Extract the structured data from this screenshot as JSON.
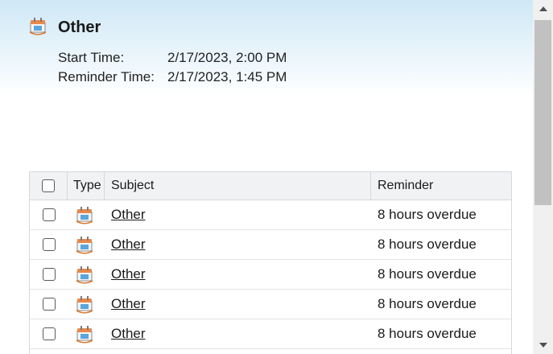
{
  "reminder": {
    "title": "Other",
    "icon": "calendar-appointment-icon",
    "start_label": "Start Time:",
    "start_value": "2/17/2023, 2:00 PM",
    "reminder_label": "Reminder Time:",
    "reminder_value": "2/17/2023, 1:45 PM"
  },
  "table": {
    "headers": {
      "type": "Type",
      "subject": "Subject",
      "reminder": "Reminder"
    },
    "rows": [
      {
        "subject": "Other",
        "reminder": "8 hours overdue",
        "icon": "calendar-appointment-icon"
      },
      {
        "subject": "Other",
        "reminder": "8 hours overdue",
        "icon": "calendar-appointment-icon"
      },
      {
        "subject": "Other",
        "reminder": "8 hours overdue",
        "icon": "calendar-appointment-icon"
      },
      {
        "subject": "Other",
        "reminder": "8 hours overdue",
        "icon": "calendar-appointment-icon"
      },
      {
        "subject": "Other",
        "reminder": "8 hours overdue",
        "icon": "calendar-appointment-icon"
      }
    ]
  },
  "colors": {
    "header_gradient_top": "#cfe8f6",
    "table_header_bg": "#f1f2f3",
    "scrollbar_thumb": "#c1c1c1"
  }
}
